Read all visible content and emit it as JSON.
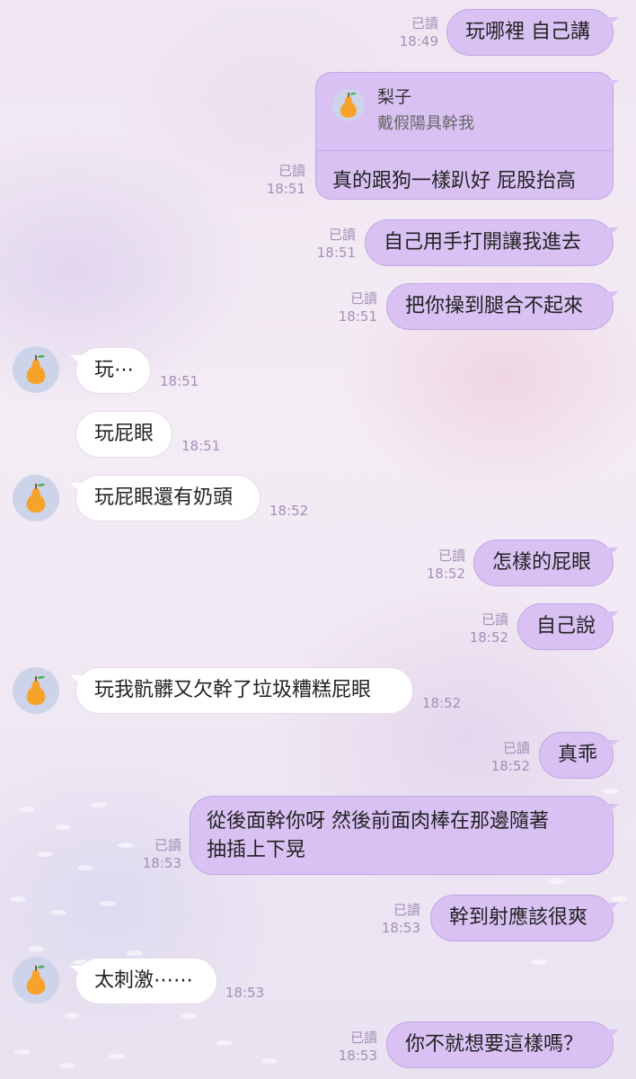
{
  "contact": {
    "name": "梨子"
  },
  "read_label": "已讀",
  "messages": [
    {
      "dir": "out",
      "text": "玩哪裡 自己講",
      "time": "18:49",
      "read": true
    },
    {
      "dir": "out",
      "reply_to": {
        "name": "梨子",
        "quote": "戴假陽具幹我"
      },
      "text": "真的跟狗一樣趴好 屁股抬高",
      "time": "18:51",
      "read": true
    },
    {
      "dir": "out",
      "text": "自己用手打開讓我進去",
      "time": "18:51",
      "read": true
    },
    {
      "dir": "out",
      "text": "把你操到腿合不起來",
      "time": "18:51",
      "read": true
    },
    {
      "dir": "in",
      "text": "玩⋯",
      "time": "18:51"
    },
    {
      "dir": "in",
      "text": "玩屁眼",
      "time": "18:51"
    },
    {
      "dir": "in",
      "text": "玩屁眼還有奶頭",
      "time": "18:52"
    },
    {
      "dir": "out",
      "text": "怎樣的屁眼",
      "time": "18:52",
      "read": true
    },
    {
      "dir": "out",
      "text": "自己說",
      "time": "18:52",
      "read": true
    },
    {
      "dir": "in",
      "text": "玩我骯髒又欠幹了垃圾糟糕屁眼",
      "time": "18:52"
    },
    {
      "dir": "out",
      "text": "真乖",
      "time": "18:52",
      "read": true
    },
    {
      "dir": "out",
      "text_lines": [
        "從後面幹你呀 然後前面肉棒在那邊隨著",
        "抽插上下晃"
      ],
      "time": "18:53",
      "read": true
    },
    {
      "dir": "out",
      "text": "幹到射應該很爽",
      "time": "18:53",
      "read": true
    },
    {
      "dir": "in",
      "text": "太刺激⋯⋯",
      "time": "18:53"
    },
    {
      "dir": "out",
      "text": "你不就想要這樣嗎？",
      "time": "18:53",
      "read": true
    }
  ]
}
